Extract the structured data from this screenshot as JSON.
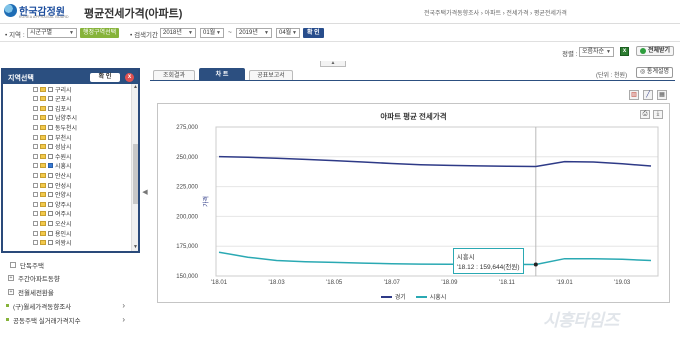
{
  "header": {
    "logo_text": "한국감정원",
    "logo_sub": "KOREA APPRAISAL BOARD",
    "page_title": "평균전세가격(아파트)",
    "breadcrumb": "전국주택가격동향조사 › 아파트 › 전세가격 › 평균전세가격"
  },
  "filters": {
    "region_label": "• 지역 :",
    "region_value": "시군구별",
    "region_button": "행정구역선택",
    "period_label": "• 검색기간 :",
    "start_year": "2018년",
    "start_month": "01월",
    "tilde": "~",
    "end_year": "2019년",
    "end_month": "04월",
    "search_button": "확 인"
  },
  "sort": {
    "label": "정렬 :",
    "value": "오름차순",
    "print_label": "전체받기"
  },
  "region_panel": {
    "title": "지역선택",
    "confirm": "확 인",
    "close": "x",
    "items": [
      {
        "name": "구리시",
        "checked": false
      },
      {
        "name": "군포시",
        "checked": false
      },
      {
        "name": "김포시",
        "checked": false
      },
      {
        "name": "남양주시",
        "checked": false
      },
      {
        "name": "동두천시",
        "checked": false
      },
      {
        "name": "부천시",
        "checked": false
      },
      {
        "name": "성남시",
        "checked": false
      },
      {
        "name": "수원시",
        "checked": false
      },
      {
        "name": "시흥시",
        "checked": true
      },
      {
        "name": "안산시",
        "checked": false
      },
      {
        "name": "안성시",
        "checked": false
      },
      {
        "name": "안양시",
        "checked": false
      },
      {
        "name": "양주시",
        "checked": false
      },
      {
        "name": "여주시",
        "checked": false
      },
      {
        "name": "오산시",
        "checked": false
      },
      {
        "name": "용인시",
        "checked": false
      },
      {
        "name": "의왕시",
        "checked": false
      }
    ]
  },
  "left_menu": {
    "sub_item": "단독주택",
    "items": [
      {
        "label": "주간아파트동향"
      },
      {
        "label": "전월세전환율"
      },
      {
        "label": "(구)월세가격동향조사"
      },
      {
        "label": "공동주택 실거래가격지수"
      }
    ]
  },
  "tabs": [
    {
      "label": "조회결과",
      "active": false
    },
    {
      "label": "차 트",
      "active": true
    },
    {
      "label": "공표보고서",
      "active": false
    }
  ],
  "unit_text": "(단위 : 천원)",
  "stats_button": "통계설명",
  "chart_data": {
    "type": "line",
    "title": "아파트 평균 전세가격",
    "ylabel": "가격",
    "ylim": [
      150000,
      275000
    ],
    "yticks": [
      150000,
      175000,
      200000,
      225000,
      250000,
      275000
    ],
    "ytick_labels": [
      "150,000",
      "175,000",
      "200,000",
      "225,000",
      "250,000",
      "275,000"
    ],
    "x": [
      "'18.01",
      "'18.02",
      "'18.03",
      "'18.04",
      "'18.05",
      "'18.06",
      "'18.07",
      "'18.08",
      "'18.09",
      "'18.10",
      "'18.11",
      "'18.12",
      "'19.01",
      "'19.02",
      "'19.03",
      "'19.04"
    ],
    "xtick_labels": [
      "'18.01",
      "'18.03",
      "'18.05",
      "'18.07",
      "'18.09",
      "'18.11",
      "'19.01",
      "'19.03"
    ],
    "series": [
      {
        "name": "경기",
        "color": "#2e3a87",
        "values": [
          250200,
          249600,
          248800,
          247800,
          246800,
          245600,
          244400,
          243400,
          242800,
          242400,
          242100,
          241900,
          246000,
          245600,
          244100,
          242300
        ]
      },
      {
        "name": "시흥시",
        "color": "#2aa9b3",
        "values": [
          170000,
          165800,
          163000,
          162000,
          161400,
          160800,
          160300,
          160000,
          159800,
          159700,
          159700,
          159644,
          164500,
          164400,
          164000,
          163000
        ]
      }
    ],
    "tooltip": {
      "series": "시흥시",
      "x_index": 11,
      "text_title": "시흥시",
      "text_body": "'18.12 : 159,644(천원)"
    },
    "legend_position": "bottom",
    "grid": true
  },
  "watermark": "시흥타임즈"
}
